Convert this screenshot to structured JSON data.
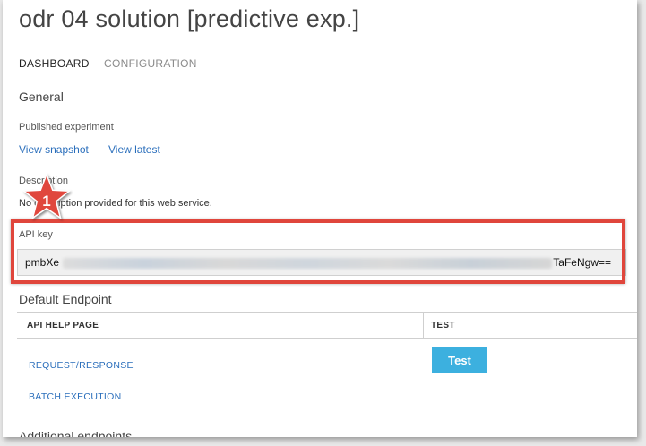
{
  "page_title": "odr 04 solution [predictive exp.]",
  "tabs": [
    {
      "label": "DASHBOARD",
      "active": true
    },
    {
      "label": "CONFIGURATION",
      "active": false
    }
  ],
  "general": {
    "heading": "General",
    "published_label": "Published experiment",
    "view_snapshot": "View snapshot",
    "view_latest": "View latest",
    "description_label": "Description",
    "description_text": "No description provided for this web service."
  },
  "api_key": {
    "label": "API key",
    "value_visible_prefix": "pmbXe",
    "value_visible_suffix": "TaFeNgw=="
  },
  "callout": {
    "number": "1",
    "color": "#e0463c"
  },
  "default_endpoint": {
    "heading": "Default Endpoint",
    "columns": [
      "API HELP PAGE",
      "TEST"
    ],
    "links": [
      "REQUEST/RESPONSE",
      "BATCH EXECUTION"
    ],
    "test_button": "Test"
  },
  "additional_endpoints": {
    "heading": "Additional endpoints"
  },
  "colors": {
    "link": "#2a6ebb",
    "accent_button": "#3cb0df",
    "highlight": "#e0463c"
  }
}
